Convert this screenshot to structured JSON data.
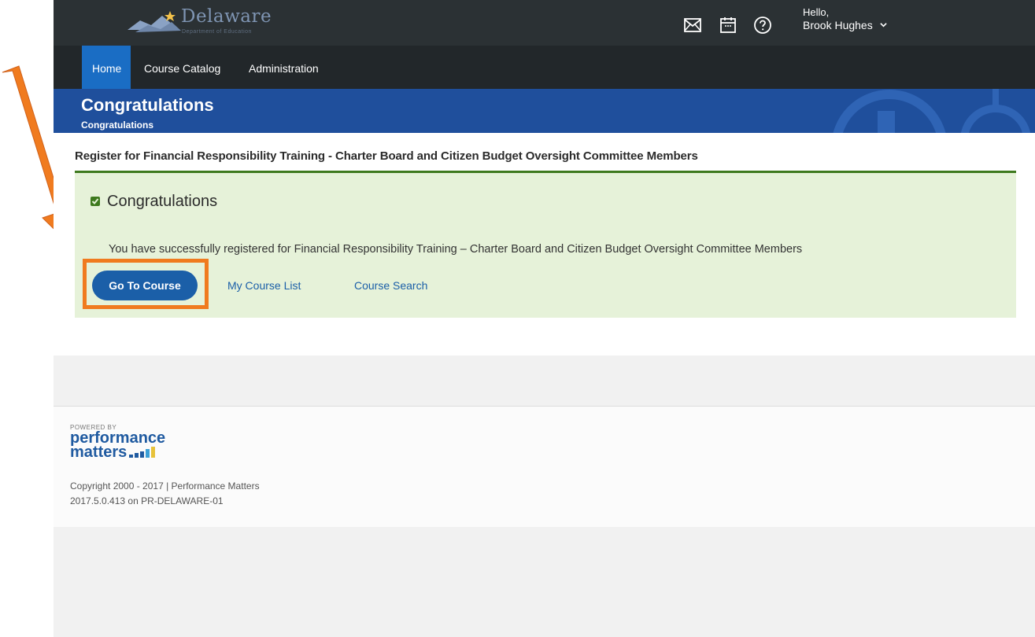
{
  "header": {
    "logo_text": "Delaware",
    "logo_subtext": "Department of Education",
    "icons": [
      "mail-icon",
      "calendar-icon",
      "help-icon"
    ],
    "greeting": "Hello,",
    "user_name": "Brook Hughes"
  },
  "nav": {
    "items": [
      {
        "label": "Home",
        "active": true
      },
      {
        "label": "Course Catalog",
        "active": false
      },
      {
        "label": "Administration",
        "active": false
      }
    ]
  },
  "banner": {
    "title": "Congratulations",
    "subtitle": "Congratulations"
  },
  "main": {
    "register_title": "Register for Financial Responsibility Training - Charter Board and Citizen Budget Oversight Committee Members",
    "box_title": "Congratulations",
    "message": "You have successfully registered for Financial Responsibility Training – Charter Board and Citizen Budget Oversight Committee Members",
    "go_button": "Go To Course",
    "my_course_list": "My Course List",
    "course_search": "Course Search"
  },
  "footer": {
    "powered_by": "POWERED BY",
    "brand_line1": "performance",
    "brand_line2": "matters",
    "copyright": "Copyright 2000 - 2017 | Performance Matters",
    "version": "2017.5.0.413 on PR-DELAWARE-01"
  },
  "colors": {
    "topbar": "#2b3134",
    "nav_active": "#1a6dc4",
    "banner": "#1f4f9c",
    "success_bg": "#e6f2d9",
    "success_rule": "#3e7a1e",
    "primary_button": "#1b5fa8",
    "annotation": "#f07b1f"
  }
}
